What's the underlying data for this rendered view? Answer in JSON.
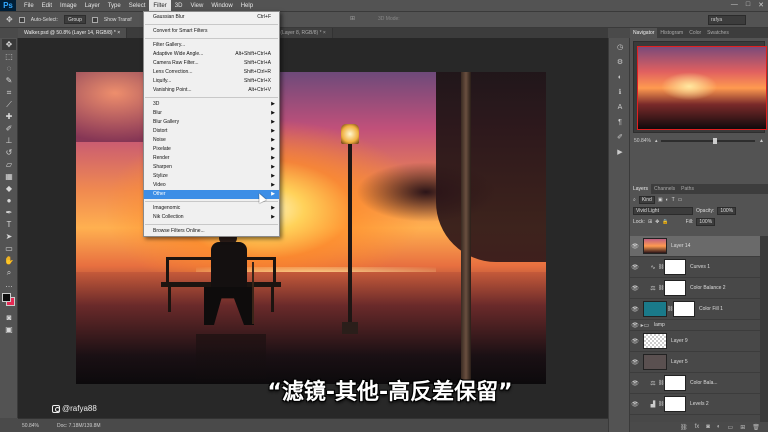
{
  "app": {
    "logo": "Ps"
  },
  "menu": [
    "File",
    "Edit",
    "Image",
    "Layer",
    "Type",
    "Select",
    "Filter",
    "3D",
    "View",
    "Window",
    "Help"
  ],
  "window_controls": [
    "—",
    "□",
    "✕"
  ],
  "options_bar": {
    "auto_select_label": "Auto-Select:",
    "auto_select_value": "Group",
    "show_transform_label": "Show Transf",
    "mode_label": "3D Mode:",
    "workspace": "rafya"
  },
  "doc_tabs": [
    {
      "label": "Walker.psd @ 50.8% (Layer 14, RGB/8) * ×"
    },
    {
      "label": "25% (Layer 8, RGB/8) * ×"
    }
  ],
  "filter_menu": {
    "items": [
      {
        "label": "Gaussian Blur",
        "shortcut": "Ctrl+F"
      },
      {
        "sep": true
      },
      {
        "label": "Convert for Smart Filters"
      },
      {
        "sep": true
      },
      {
        "label": "Filter Gallery..."
      },
      {
        "label": "Adaptive Wide Angle...",
        "shortcut": "Alt+Shift+Ctrl+A"
      },
      {
        "label": "Camera Raw Filter...",
        "shortcut": "Shift+Ctrl+A"
      },
      {
        "label": "Lens Correction...",
        "shortcut": "Shift+Ctrl+R"
      },
      {
        "label": "Liquify...",
        "shortcut": "Shift+Ctrl+X"
      },
      {
        "label": "Vanishing Point...",
        "shortcut": "Alt+Ctrl+V"
      },
      {
        "sep": true
      },
      {
        "label": "3D",
        "sub": true
      },
      {
        "label": "Blur",
        "sub": true
      },
      {
        "label": "Blur Gallery",
        "sub": true
      },
      {
        "label": "Distort",
        "sub": true
      },
      {
        "label": "Noise",
        "sub": true
      },
      {
        "label": "Pixelate",
        "sub": true
      },
      {
        "label": "Render",
        "sub": true
      },
      {
        "label": "Sharpen",
        "sub": true
      },
      {
        "label": "Stylize",
        "sub": true
      },
      {
        "label": "Video",
        "sub": true
      },
      {
        "label": "Other",
        "sub": true,
        "highlighted": true
      },
      {
        "sep": true
      },
      {
        "label": "Imagenomic",
        "sub": true
      },
      {
        "label": "Nik Collection",
        "sub": true
      },
      {
        "sep": true
      },
      {
        "label": "Browse Filters Online..."
      }
    ]
  },
  "subtitle": "“滤镜-其他-高反差保留”",
  "watermark": "@rafya88",
  "status": {
    "zoom": "50.84%",
    "doc": "Doc: 7.18M/139.8M"
  },
  "panels": {
    "top_tabs": [
      "Navigator",
      "Histogram",
      "Color",
      "Swatches"
    ],
    "nav_zoom": "50.84%",
    "layer_tabs": [
      "Layers",
      "Channels",
      "Paths"
    ],
    "kind": "Kind",
    "blend_mode": "Vivid Light",
    "opacity_label": "Opacity:",
    "opacity": "100%",
    "lock_label": "Lock:",
    "fill_label": "Fill:",
    "fill": "100%"
  },
  "layers": [
    {
      "name": "Layer 14",
      "thumb": "scene",
      "active": true
    },
    {
      "name": "Curves 1",
      "thumb": "adj",
      "icon": "curves-icon",
      "glyph": "∿"
    },
    {
      "name": "Color Balance 2",
      "thumb": "adj",
      "icon": "balance-icon",
      "glyph": "⚖"
    },
    {
      "name": "Color Fill 1",
      "thumb": "teal"
    },
    {
      "name": "lamp",
      "group": true
    },
    {
      "name": "Layer 9",
      "thumb": "checker"
    },
    {
      "name": "Layer 5",
      "thumb": "gray"
    },
    {
      "name": "Color Bala...",
      "thumb": "adj",
      "icon": "balance-icon",
      "glyph": "⚖"
    },
    {
      "name": "Levels 2",
      "thumb": "adj",
      "icon": "levels-icon",
      "glyph": "▟"
    }
  ],
  "colors": {
    "accent": "#3d8ee6",
    "background_swatch": "#e52a53",
    "foreground_swatch": "#0d0d0d"
  }
}
